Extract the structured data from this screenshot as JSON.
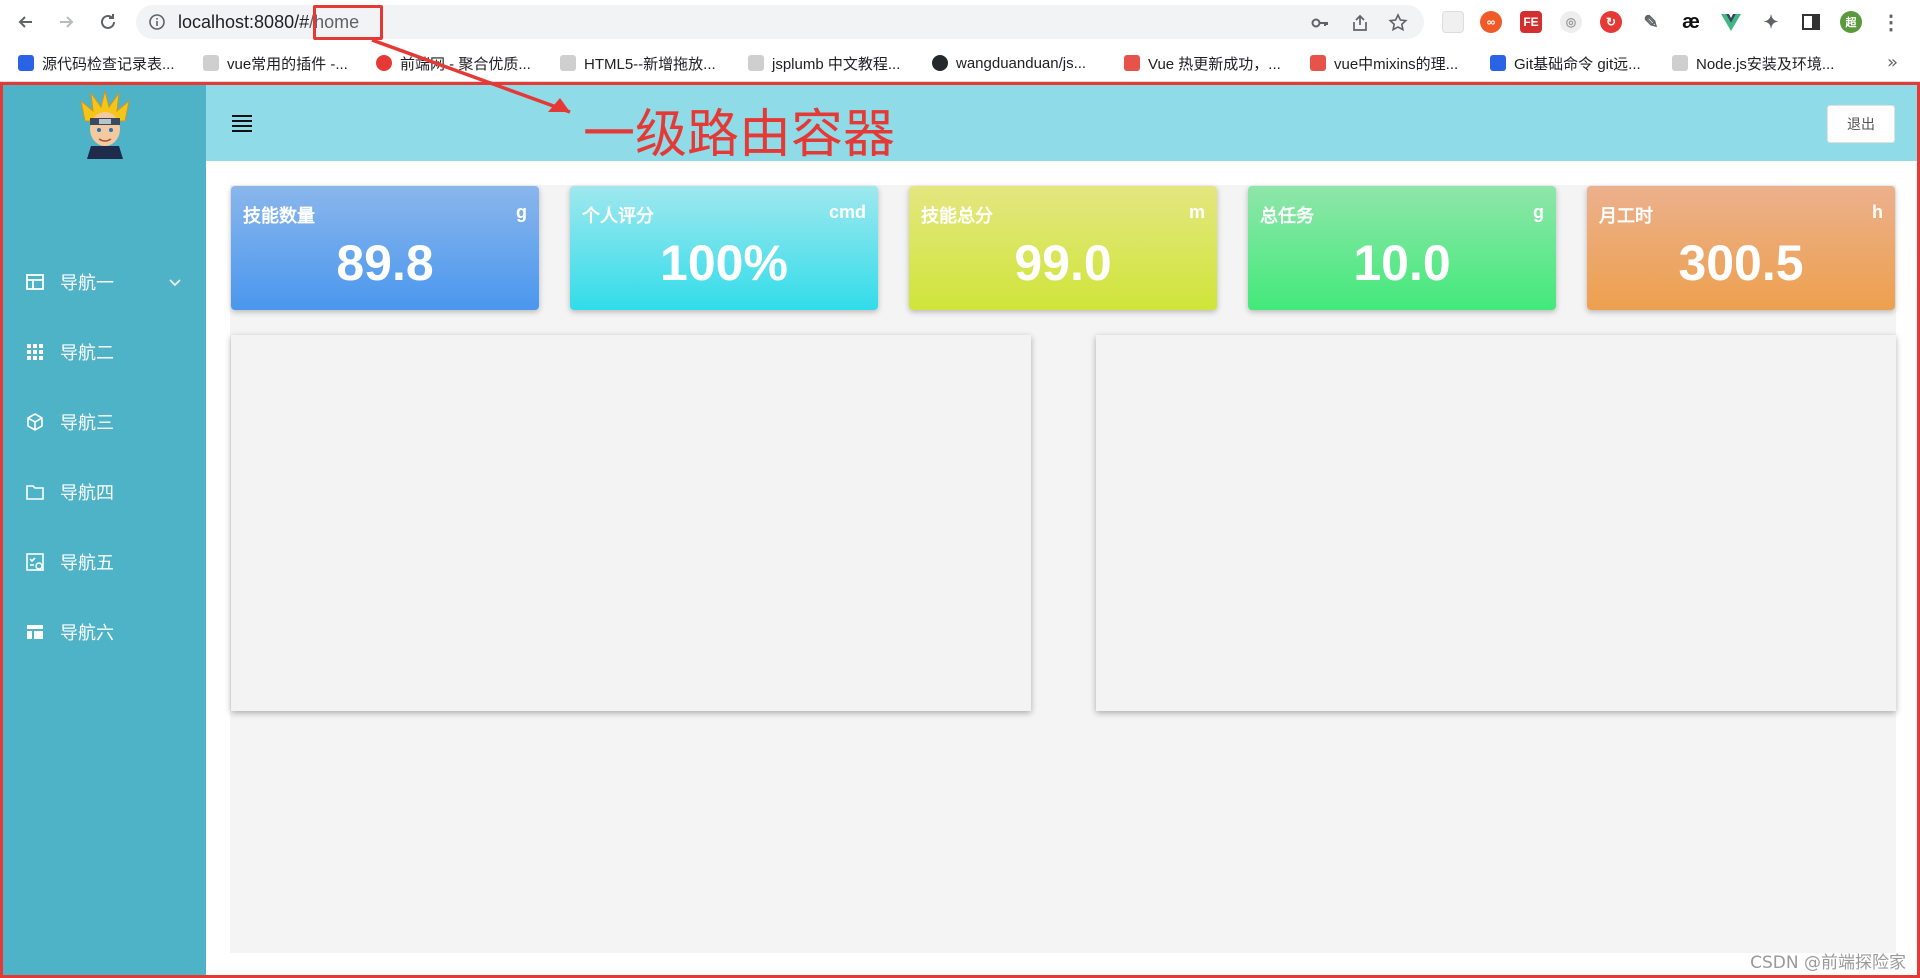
{
  "browser": {
    "url_host": "localhost:8080/#",
    "url_path": "/home",
    "profile_initial": "超",
    "bookmarks": [
      {
        "label": "源代码检查记录表..."
      },
      {
        "label": "vue常用的插件 -..."
      },
      {
        "label": "前端网 - 聚合优质..."
      },
      {
        "label": "HTML5--新增拖放..."
      },
      {
        "label": "jsplumb 中文教程..."
      },
      {
        "label": "wangduanduan/js..."
      },
      {
        "label": "Vue 热更新成功，..."
      },
      {
        "label": "vue中mixins的理..."
      },
      {
        "label": "Git基础命令 git远..."
      },
      {
        "label": "Node.js安装及环境..."
      }
    ],
    "bookmarks_more": "»"
  },
  "sidebar": {
    "items": [
      {
        "label": "导航一",
        "icon": "table-icon"
      },
      {
        "label": "导航二",
        "icon": "grid-icon"
      },
      {
        "label": "导航三",
        "icon": "cube-icon"
      },
      {
        "label": "导航四",
        "icon": "folder-icon"
      },
      {
        "label": "导航五",
        "icon": "checklist-icon"
      },
      {
        "label": "导航六",
        "icon": "table-layout-icon"
      }
    ]
  },
  "header": {
    "logout_label": "退出"
  },
  "stats": [
    {
      "title": "技能数量",
      "unit": "g",
      "value": "89.8",
      "color_from": "#8ab6ec",
      "color_to": "#4a97ee"
    },
    {
      "title": "个人评分",
      "unit": "cmd",
      "value": "100%",
      "color_from": "#9fe8ee",
      "color_to": "#32dcea"
    },
    {
      "title": "技能总分",
      "unit": "m",
      "value": "99.0",
      "color_from": "#e4e680",
      "color_to": "#cfe53a"
    },
    {
      "title": "总任务",
      "unit": "g",
      "value": "10.0",
      "color_from": "#8fe6a9",
      "color_to": "#43e97b"
    },
    {
      "title": "月工时",
      "unit": "h",
      "value": "300.5",
      "color_from": "#ecb08c",
      "color_to": "#eda04e"
    }
  ],
  "annotation": {
    "text": "一级路由容器"
  },
  "watermark": "CSDN @前端探险家",
  "colors": {
    "sidebar": "#4fb3c8",
    "header": "#8fdbe7",
    "annotation": "#e53935"
  }
}
